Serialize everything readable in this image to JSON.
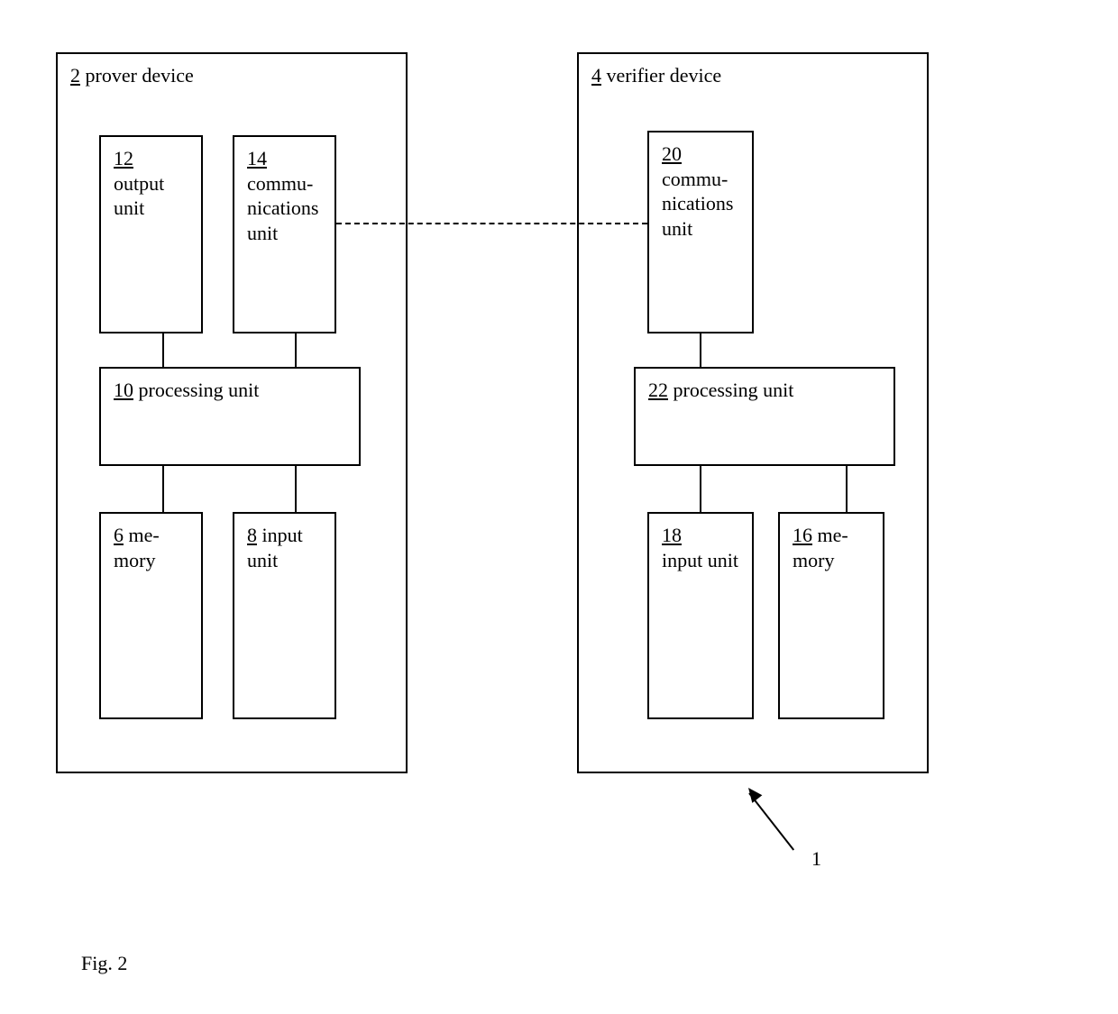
{
  "caption": "Fig. 2",
  "system_ref": "1",
  "prover": {
    "ref": "2",
    "name": "prover device",
    "children": {
      "output_unit": {
        "ref": "12",
        "name": "output unit"
      },
      "comm_unit": {
        "ref": "14",
        "name": "commu­nica­tions unit"
      },
      "processing": {
        "ref": "10",
        "name": "processing unit"
      },
      "memory": {
        "ref": "6",
        "name": "me­mory"
      },
      "input_unit": {
        "ref": "8",
        "name": "input unit"
      }
    }
  },
  "verifier": {
    "ref": "4",
    "name": "verifier device",
    "children": {
      "comm_unit": {
        "ref": "20",
        "name": "commu­nica­tions unit"
      },
      "processing": {
        "ref": "22",
        "name": "processing unit"
      },
      "input_unit": {
        "ref": "18",
        "name": "input unit"
      },
      "memory": {
        "ref": "16",
        "name": "me­mory"
      }
    }
  }
}
